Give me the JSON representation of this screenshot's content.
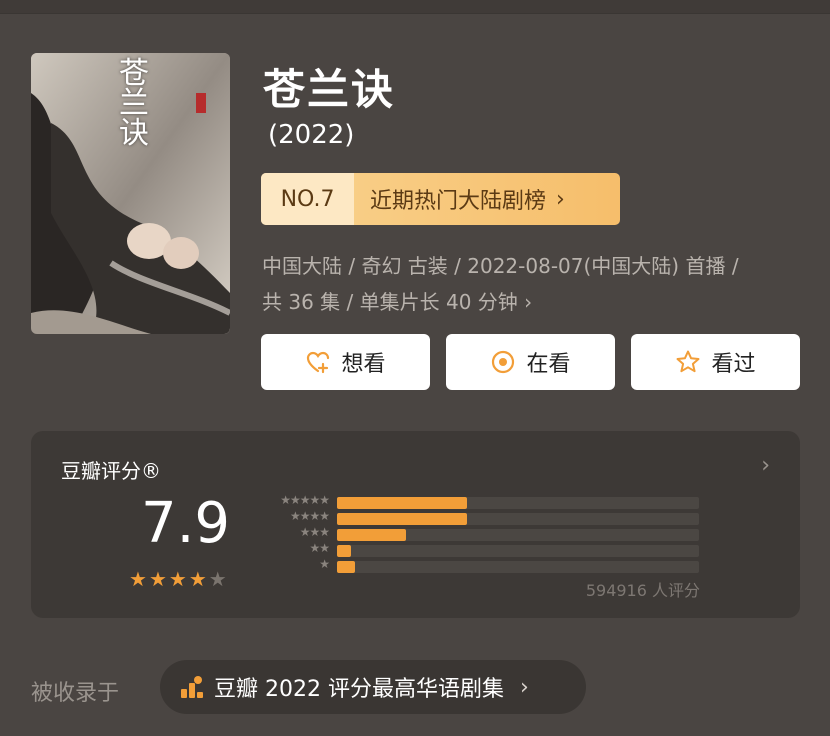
{
  "work": {
    "title": "苍兰诀",
    "year": "(2022)",
    "poster_title": "苍兰诀"
  },
  "rank": {
    "number": "NO.7",
    "label": "近期热门大陆剧榜",
    "chevron": "›"
  },
  "meta": {
    "line1": "中国大陆 / 奇幻 古装 / 2022-08-07(中国大陆) 首播 /",
    "line2": "共 36 集 / 单集片长 40 分钟 ›"
  },
  "actions": [
    {
      "label": "想看",
      "icon": "heart-plus-icon"
    },
    {
      "label": "在看",
      "icon": "target-icon"
    },
    {
      "label": "看过",
      "icon": "star-outline-icon"
    }
  ],
  "rating": {
    "panel_title": "豆瓣评分®",
    "score": "7.9",
    "stars_filled": 4,
    "stars_total": 5,
    "count_text": "594916 人评分",
    "distribution": [
      {
        "stars": 5,
        "fraction": 0.36
      },
      {
        "stars": 4,
        "fraction": 0.36
      },
      {
        "stars": 3,
        "fraction": 0.19
      },
      {
        "stars": 2,
        "fraction": 0.04
      },
      {
        "stars": 1,
        "fraction": 0.05
      }
    ]
  },
  "included": {
    "label": "被收录于",
    "chip_text": "豆瓣 2022 评分最高华语剧集",
    "chip_icon": "ranking-bars-icon",
    "chevron": "›"
  },
  "colors": {
    "accent": "#f29e38",
    "background": "#4a4542",
    "panel": "#3d3936"
  }
}
